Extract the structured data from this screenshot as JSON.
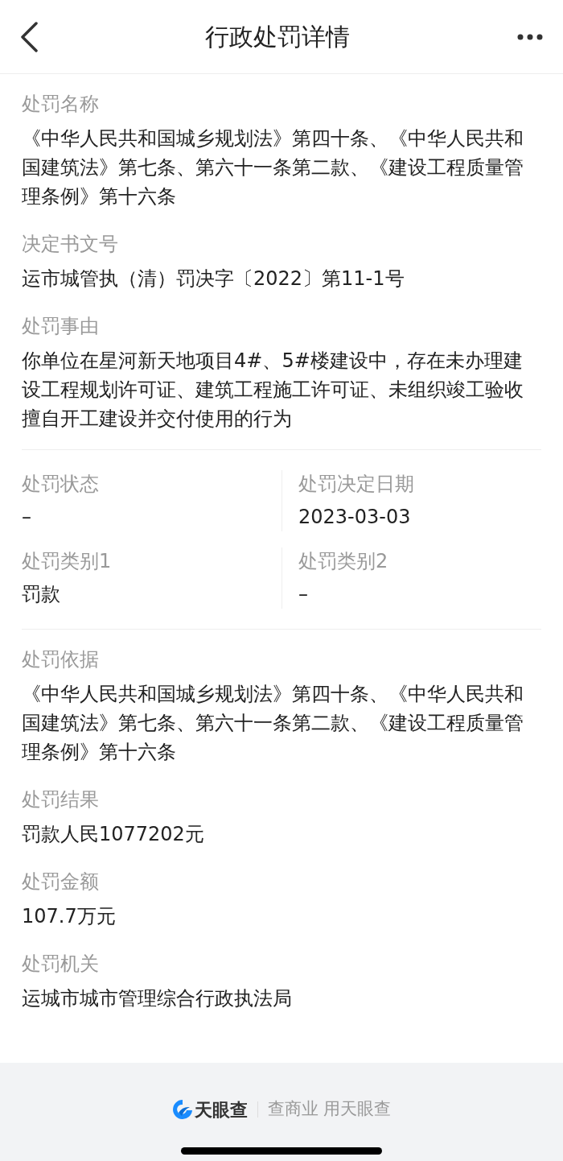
{
  "header": {
    "title": "行政处罚详情"
  },
  "sections": [
    {
      "kind": "list",
      "fields": [
        {
          "label": "处罚名称",
          "value": "《中华人民共和国城乡规划法》第四十条、《中华人民共和国建筑法》第七条、第六十一条第二款、《建设工程质量管理条例》第十六条"
        },
        {
          "label": "决定书文号",
          "value": "运市城管执（清）罚决字〔2022〕第11-1号"
        },
        {
          "label": "处罚事由",
          "value": "你单位在星河新天地项目4#、5#楼建设中，存在未办理建设工程规划许可证、建筑工程施工许可证、未组织竣工验收擅自开工建设并交付使用的行为"
        }
      ]
    },
    {
      "kind": "grid",
      "fields": [
        {
          "label": "处罚状态",
          "value": "–"
        },
        {
          "label": "处罚决定日期",
          "value": "2023-03-03"
        },
        {
          "label": "处罚类别1",
          "value": "罚款"
        },
        {
          "label": "处罚类别2",
          "value": "–"
        }
      ]
    },
    {
      "kind": "list",
      "fields": [
        {
          "label": "处罚依据",
          "value": "《中华人民共和国城乡规划法》第四十条、《中华人民共和国建筑法》第七条、第六十一条第二款、《建设工程质量管理条例》第十六条"
        },
        {
          "label": "处罚结果",
          "value": "罚款人民1077202元"
        },
        {
          "label": "处罚金额",
          "value": "107.7万元"
        },
        {
          "label": "处罚机关",
          "value": "运城市城市管理综合行政执法局"
        }
      ]
    }
  ],
  "footer": {
    "brand": "天眼查",
    "slogan": "查商业 用天眼查"
  }
}
